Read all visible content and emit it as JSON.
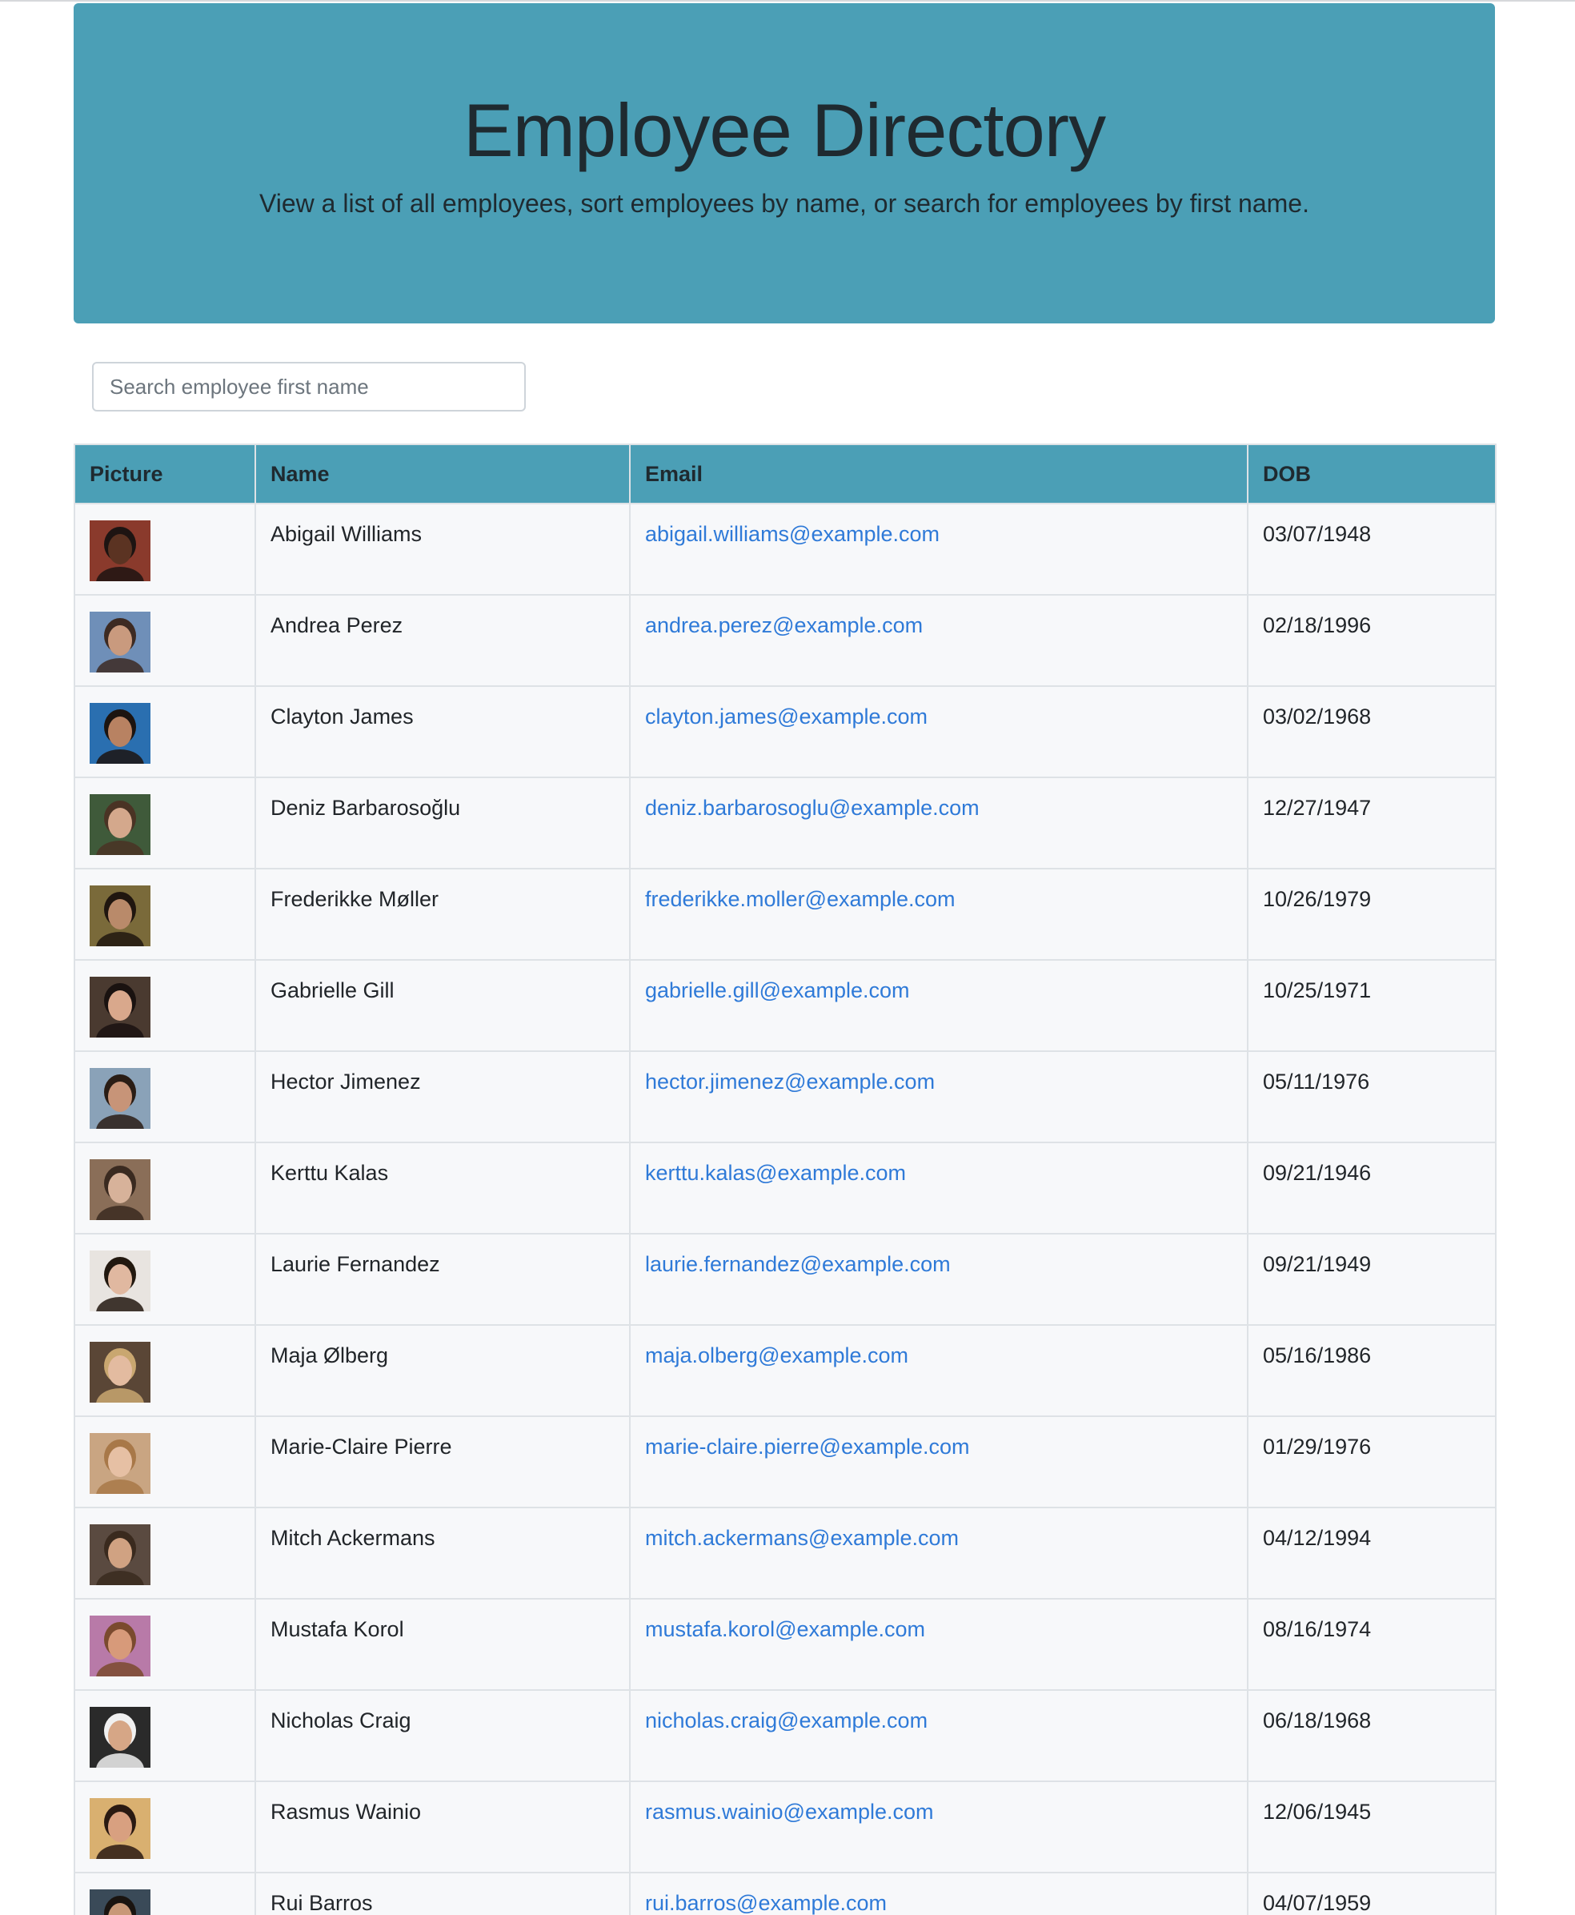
{
  "header": {
    "title": "Employee Directory",
    "subtitle": "View a list of all employees, sort employees by name, or search for employees by first name."
  },
  "search": {
    "placeholder": "Search employee first name",
    "value": ""
  },
  "table": {
    "columns": [
      "Picture",
      "Name",
      "Email",
      "DOB"
    ],
    "rows": [
      {
        "name": "Abigail Williams",
        "email": "abigail.williams@example.com",
        "dob": "03/07/1948",
        "bg": "#8a3a2c",
        "skin": "#5b3322",
        "hair": "#1d1412"
      },
      {
        "name": "Andrea Perez",
        "email": "andrea.perez@example.com",
        "dob": "02/18/1996",
        "bg": "#6f8fb8",
        "skin": "#c99a7e",
        "hair": "#3d2a22"
      },
      {
        "name": "Clayton James",
        "email": "clayton.james@example.com",
        "dob": "03/02/1968",
        "bg": "#2a6fb0",
        "skin": "#b88262",
        "hair": "#1c1410"
      },
      {
        "name": "Deniz Barbarosoğlu",
        "email": "deniz.barbarosoglu@example.com",
        "dob": "12/27/1947",
        "bg": "#3f5a3a",
        "skin": "#d4a88c",
        "hair": "#4a3324"
      },
      {
        "name": "Frederikke Møller",
        "email": "frederikke.moller@example.com",
        "dob": "10/26/1979",
        "bg": "#7a6a3a",
        "skin": "#b98a6a",
        "hair": "#20160f"
      },
      {
        "name": "Gabrielle Gill",
        "email": "gabrielle.gill@example.com",
        "dob": "10/25/1971",
        "bg": "#4a3a30",
        "skin": "#d9a88c",
        "hair": "#1a1210"
      },
      {
        "name": "Hector Jimenez",
        "email": "hector.jimenez@example.com",
        "dob": "05/11/1976",
        "bg": "#8aa2b8",
        "skin": "#c79478",
        "hair": "#2a1d15"
      },
      {
        "name": "Kerttu Kalas",
        "email": "kerttu.kalas@example.com",
        "dob": "09/21/1946",
        "bg": "#8a6e58",
        "skin": "#d7b29a",
        "hair": "#3a2a20"
      },
      {
        "name": "Laurie Fernandez",
        "email": "laurie.fernandez@example.com",
        "dob": "09/21/1949",
        "bg": "#e8e4e0",
        "skin": "#e0b8a0",
        "hair": "#22180f"
      },
      {
        "name": "Maja Ølberg",
        "email": "maja.olberg@example.com",
        "dob": "05/16/1986",
        "bg": "#5a4636",
        "skin": "#e3bba0",
        "hair": "#c9a770"
      },
      {
        "name": "Marie-Claire Pierre",
        "email": "marie-claire.pierre@example.com",
        "dob": "01/29/1976",
        "bg": "#c9a582",
        "skin": "#e6c0a4",
        "hair": "#a87848"
      },
      {
        "name": "Mitch Ackermans",
        "email": "mitch.ackermans@example.com",
        "dob": "04/12/1994",
        "bg": "#5a4a40",
        "skin": "#d0a282",
        "hair": "#3a2a1e"
      },
      {
        "name": "Mustafa Korol",
        "email": "mustafa.korol@example.com",
        "dob": "08/16/1974",
        "bg": "#b87aa8",
        "skin": "#d79a7a",
        "hair": "#7a4a2e"
      },
      {
        "name": "Nicholas Craig",
        "email": "nicholas.craig@example.com",
        "dob": "06/18/1968",
        "bg": "#2a2a2a",
        "skin": "#d6a686",
        "hair": "#f0f0f0"
      },
      {
        "name": "Rasmus Wainio",
        "email": "rasmus.wainio@example.com",
        "dob": "12/06/1945",
        "bg": "#d9b070",
        "skin": "#d8a080",
        "hair": "#2a1a12"
      },
      {
        "name": "Rui Barros",
        "email": "rui.barros@example.com",
        "dob": "04/07/1959",
        "bg": "#3a4a58",
        "skin": "#c89878",
        "hair": "#1a1410"
      }
    ]
  }
}
